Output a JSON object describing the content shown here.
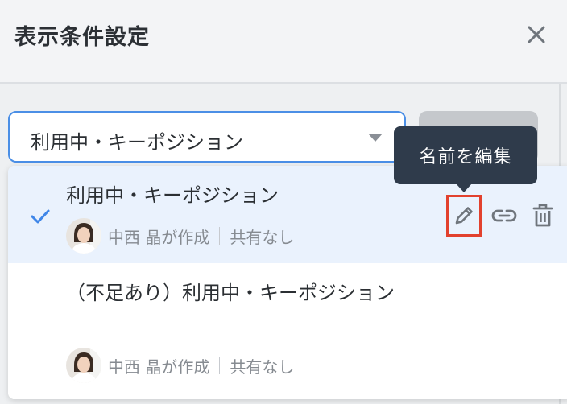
{
  "dialog": {
    "title": "表示条件設定",
    "close_icon": "close-icon"
  },
  "select": {
    "value": "利用中・キーポジション"
  },
  "tooltip": {
    "text": "名前を編集"
  },
  "options": [
    {
      "name": "利用中・キーポジション",
      "selected": true,
      "creator": "中西 晶が作成",
      "sharing": "共有なし"
    },
    {
      "name": "（不足あり）利用中・キーポジション",
      "selected": false,
      "creator": "中西 晶が作成",
      "sharing": "共有なし"
    }
  ],
  "icons": [
    "close-icon",
    "caret-down-icon",
    "check-icon",
    "pencil-icon",
    "link-icon",
    "trash-icon",
    "avatar"
  ],
  "colors": {
    "accent": "#4b8fe6",
    "selected_bg": "#eaf2fd",
    "tooltip_bg": "#2f3b4b",
    "highlight": "#e2412e"
  }
}
